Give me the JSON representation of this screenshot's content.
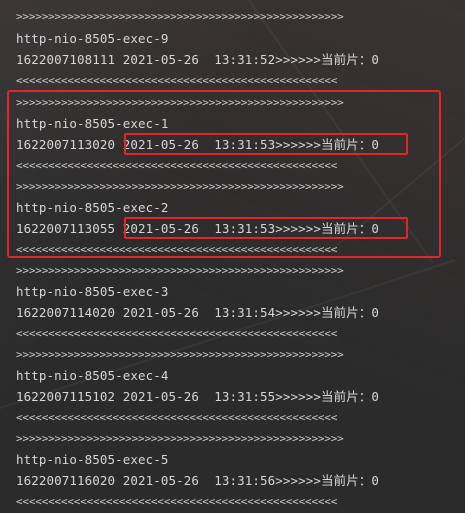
{
  "log": [
    {
      "text": ">>>>>>>>>>>>>>>>>>>>>>>>>>>>>>>>>>>>>>>>>>>>>>>>>>>",
      "kind": "arrows"
    },
    {
      "text": "http-nio-8505-exec-9",
      "kind": "thread"
    },
    {
      "text": "1622007108111 2021-05-26  13:31:52>>>>>>当前片：0",
      "kind": "info"
    },
    {
      "text": "<<<<<<<<<<<<<<<<<<<<<<<<<<<<<<<<<<<<<<<<<<<<<<<<<<",
      "kind": "arrows"
    },
    {
      "text": ">>>>>>>>>>>>>>>>>>>>>>>>>>>>>>>>>>>>>>>>>>>>>>>>>>>",
      "kind": "arrows"
    },
    {
      "text": "http-nio-8505-exec-1",
      "kind": "thread"
    },
    {
      "text": "1622007113020 2021-05-26  13:31:53>>>>>>当前片：0",
      "kind": "info"
    },
    {
      "text": "<<<<<<<<<<<<<<<<<<<<<<<<<<<<<<<<<<<<<<<<<<<<<<<<<<",
      "kind": "arrows"
    },
    {
      "text": ">>>>>>>>>>>>>>>>>>>>>>>>>>>>>>>>>>>>>>>>>>>>>>>>>>>",
      "kind": "arrows"
    },
    {
      "text": "http-nio-8505-exec-2",
      "kind": "thread"
    },
    {
      "text": "1622007113055 2021-05-26  13:31:53>>>>>>当前片：0",
      "kind": "info"
    },
    {
      "text": "<<<<<<<<<<<<<<<<<<<<<<<<<<<<<<<<<<<<<<<<<<<<<<<<<<",
      "kind": "arrows"
    },
    {
      "text": ">>>>>>>>>>>>>>>>>>>>>>>>>>>>>>>>>>>>>>>>>>>>>>>>>>>",
      "kind": "arrows"
    },
    {
      "text": "http-nio-8505-exec-3",
      "kind": "thread"
    },
    {
      "text": "1622007114020 2021-05-26  13:31:54>>>>>>当前片：0",
      "kind": "info"
    },
    {
      "text": "<<<<<<<<<<<<<<<<<<<<<<<<<<<<<<<<<<<<<<<<<<<<<<<<<<",
      "kind": "arrows"
    },
    {
      "text": ">>>>>>>>>>>>>>>>>>>>>>>>>>>>>>>>>>>>>>>>>>>>>>>>>>>",
      "kind": "arrows"
    },
    {
      "text": "http-nio-8505-exec-4",
      "kind": "thread"
    },
    {
      "text": "1622007115102 2021-05-26  13:31:55>>>>>>当前片：0",
      "kind": "info"
    },
    {
      "text": "<<<<<<<<<<<<<<<<<<<<<<<<<<<<<<<<<<<<<<<<<<<<<<<<<<",
      "kind": "arrows"
    },
    {
      "text": ">>>>>>>>>>>>>>>>>>>>>>>>>>>>>>>>>>>>>>>>>>>>>>>>>>>",
      "kind": "arrows"
    },
    {
      "text": "http-nio-8505-exec-5",
      "kind": "thread"
    },
    {
      "text": "1622007116020 2021-05-26  13:31:56>>>>>>当前片：0",
      "kind": "info"
    },
    {
      "text": "<<<<<<<<<<<<<<<<<<<<<<<<<<<<<<<<<<<<<<<<<<<<<<<<<<",
      "kind": "arrows"
    }
  ],
  "colors": {
    "background": "#2b2b2b",
    "text": "#d6d6d6",
    "highlight": "#e0252b"
  }
}
